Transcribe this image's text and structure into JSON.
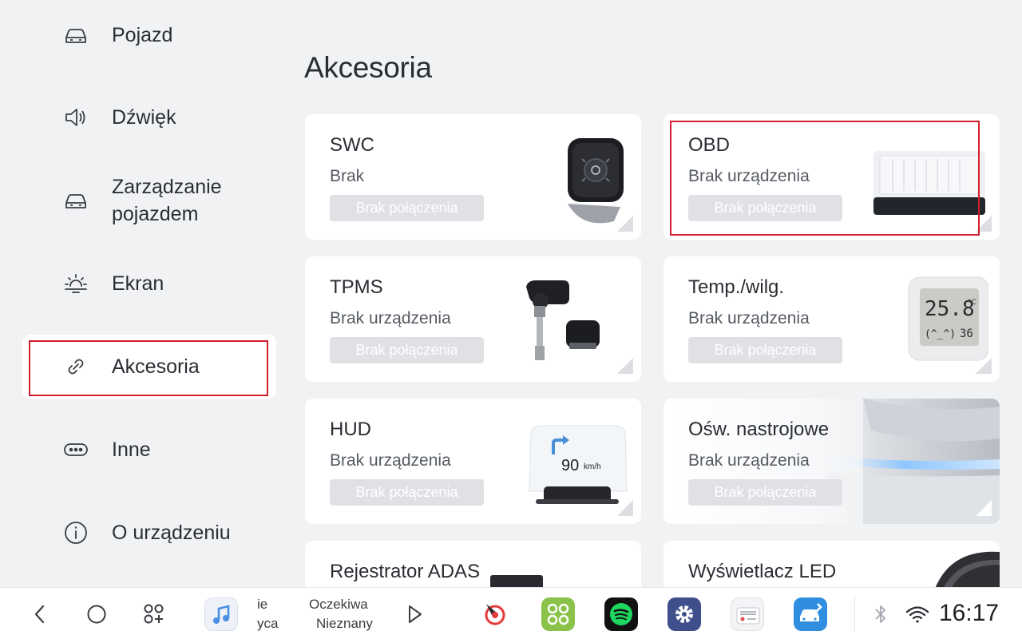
{
  "sidebar": {
    "items": [
      {
        "label": "Pojazd",
        "icon": "car-icon"
      },
      {
        "label": "Dźwięk",
        "icon": "speaker-icon"
      },
      {
        "label": "Zarządzanie pojazdem",
        "icon": "car-manage-icon"
      },
      {
        "label": "Ekran",
        "icon": "brightness-icon"
      },
      {
        "label": "Akcesoria",
        "icon": "link-icon",
        "active": true
      },
      {
        "label": "Inne",
        "icon": "more-icon"
      },
      {
        "label": "O urządzeniu",
        "icon": "info-icon"
      }
    ]
  },
  "main": {
    "title": "Akcesoria",
    "cards": [
      {
        "title": "SWC",
        "status": "Brak",
        "button": "Brak połączenia",
        "image": "steering-wheel-controller"
      },
      {
        "title": "OBD",
        "status": "Brak urządzenia",
        "button": "Brak połączenia",
        "image": "obd-device"
      },
      {
        "title": "TPMS",
        "status": "Brak urządzenia",
        "button": "Brak połączenia",
        "image": "tire-pressure-sensor"
      },
      {
        "title": "Temp./wilg.",
        "status": "Brak urządzenia",
        "button": "Brak połączenia",
        "image": "thermo-hygrometer",
        "display_temp": "25.8",
        "display_unit": "°C",
        "display_hum": "36"
      },
      {
        "title": "HUD",
        "status": "Brak urządzenia",
        "button": "Brak połączenia",
        "image": "head-up-display",
        "display_speed": "90",
        "display_speed_unit": "km/h"
      },
      {
        "title": "Ośw. nastrojowe",
        "status": "Brak urządzenia",
        "button": "Brak połączenia",
        "image": "ambient-lighting"
      },
      {
        "title": "Rejestrator ADAS",
        "status": "",
        "button": "",
        "image": "adas-recorder"
      },
      {
        "title": "Wyświetlacz LED",
        "status": "",
        "button": "",
        "image": "led-display"
      }
    ]
  },
  "taskbar": {
    "media_left_line1": "ie",
    "media_left_line2": "yca",
    "media_title": "Oczekiwa",
    "media_artist": "Nieznany",
    "clock": "16:17"
  },
  "colors": {
    "highlight": "#d21f2b",
    "background": "#f1f2f4",
    "card": "#ffffff",
    "button_disabled": "#dfe1e5"
  }
}
